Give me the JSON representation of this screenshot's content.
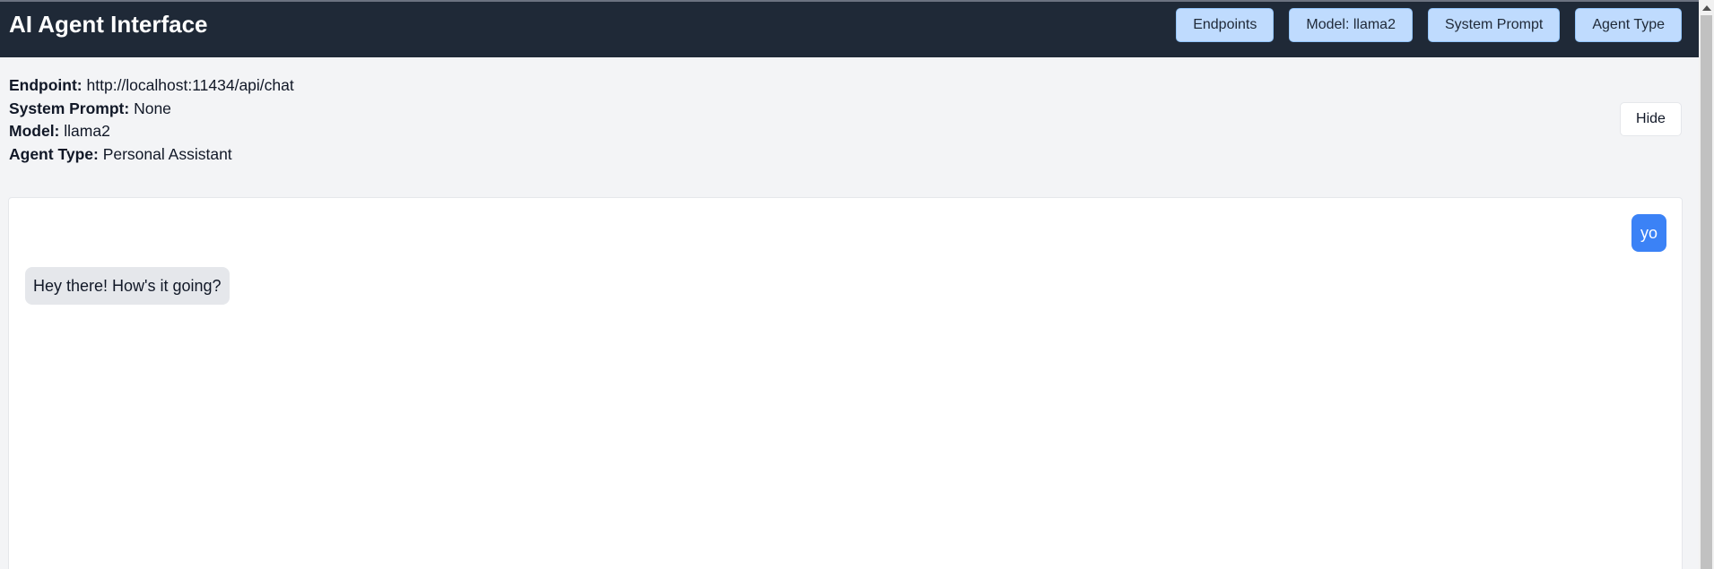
{
  "header": {
    "title": "AI Agent Interface",
    "buttons": {
      "endpoints": "Endpoints",
      "model": "Model: llama2",
      "system_prompt": "System Prompt",
      "agent_type": "Agent Type"
    }
  },
  "info": {
    "rows": [
      {
        "label": "Endpoint:",
        "value": "http://localhost:11434/api/chat"
      },
      {
        "label": "System Prompt:",
        "value": "None"
      },
      {
        "label": "Model:",
        "value": "llama2"
      },
      {
        "label": "Agent Type:",
        "value": "Personal Assistant"
      }
    ],
    "hide_label": "Hide"
  },
  "chat": {
    "messages": [
      {
        "role": "user",
        "text": "yo"
      },
      {
        "role": "assistant",
        "text": "Hey there! How's it going?"
      }
    ]
  },
  "colors": {
    "header_bg": "#1f2937",
    "nav_button_bg": "#bfdbfe",
    "user_bubble": "#3b82f6",
    "assistant_bubble": "#e5e7eb"
  },
  "icons": {
    "scroll_up": "scroll-up-arrow-icon"
  }
}
